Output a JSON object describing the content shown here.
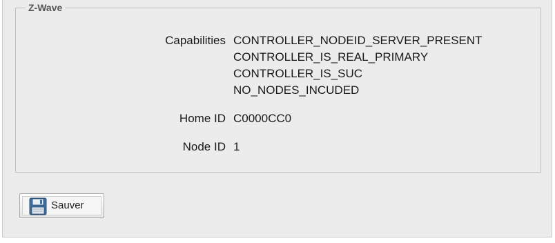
{
  "section": {
    "legend": "Z-Wave"
  },
  "details": {
    "capabilities_label": "Capabilities",
    "capabilities": [
      "CONTROLLER_NODEID_SERVER_PRESENT",
      "CONTROLLER_IS_REAL_PRIMARY",
      "CONTROLLER_IS_SUC",
      "NO_NODES_INCUDED"
    ],
    "home_id_label": "Home ID",
    "home_id": "C0000CC0",
    "node_id_label": "Node ID",
    "node_id": "1"
  },
  "actions": {
    "save_label": "Sauver",
    "save_icon": "floppy-disk-icon"
  }
}
